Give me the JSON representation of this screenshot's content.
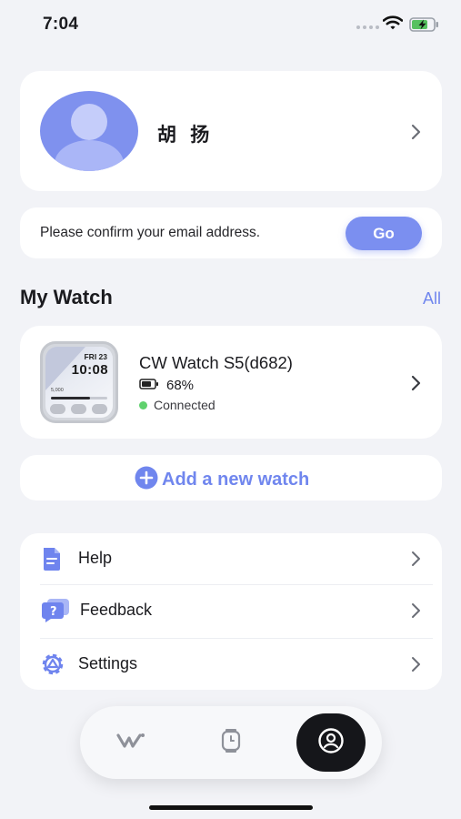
{
  "status_bar": {
    "time": "7:04"
  },
  "profile": {
    "name": "胡 扬"
  },
  "email_banner": {
    "message": "Please confirm your email address.",
    "button_label": "Go"
  },
  "my_watch": {
    "title": "My Watch",
    "all_label": "All",
    "device": {
      "name": "CW Watch S5(d682)",
      "battery": "68%",
      "status": "Connected",
      "face": {
        "date": "FRI 23",
        "time": "10:08",
        "steps": "5,000"
      }
    }
  },
  "add_watch": {
    "label": "Add a new watch"
  },
  "menu": {
    "items": [
      {
        "label": "Help",
        "icon": "document-icon"
      },
      {
        "label": "Feedback",
        "icon": "chat-question-icon"
      },
      {
        "label": "Settings",
        "icon": "gear-icon"
      }
    ]
  },
  "tab_bar": {
    "tabs": [
      {
        "icon": "brand-logo-icon",
        "active": false
      },
      {
        "icon": "watch-icon",
        "active": false
      },
      {
        "icon": "profile-icon",
        "active": true
      }
    ]
  },
  "colors": {
    "accent": "#7b8ff0",
    "background": "#f2f3f7",
    "connected": "#5fd16d",
    "tab_active": "#15161a"
  }
}
